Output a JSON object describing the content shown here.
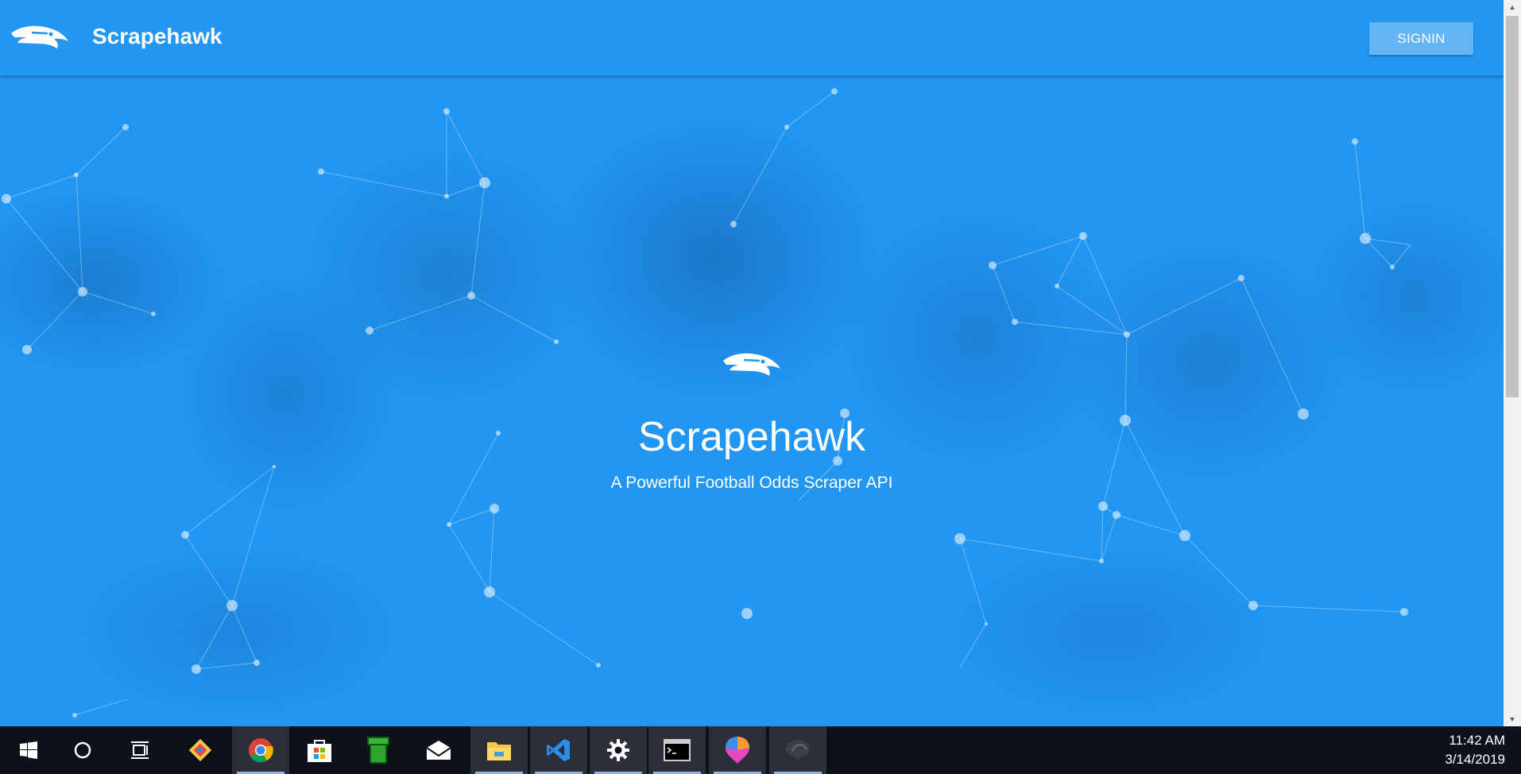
{
  "app": {
    "title": "Scrapehawk",
    "logo_icon": "seahawk-logo-icon",
    "signin_label": "SIGNIN",
    "colors": {
      "primary": "#2196F3",
      "button": "#64B5F6",
      "text": "#FFFFFF"
    }
  },
  "hero": {
    "title": "Scrapehawk",
    "subtitle": "A Powerful Football Odds Scraper API"
  },
  "taskbar": {
    "items": [
      {
        "name": "windows-start-icon",
        "active": false
      },
      {
        "name": "cortana-search-icon",
        "active": false
      },
      {
        "name": "task-view-icon",
        "active": false
      },
      {
        "name": "git-app-icon",
        "active": false
      },
      {
        "name": "chrome-icon",
        "active": true
      },
      {
        "name": "microsoft-store-icon",
        "active": false
      },
      {
        "name": "green-pipe-app-icon",
        "active": false
      },
      {
        "name": "mail-icon",
        "active": false
      },
      {
        "name": "file-explorer-icon",
        "active": true
      },
      {
        "name": "vscode-icon",
        "active": true
      },
      {
        "name": "settings-gear-icon",
        "active": true
      },
      {
        "name": "terminal-icon",
        "active": true
      },
      {
        "name": "paint-3d-icon",
        "active": true
      },
      {
        "name": "mongodb-compass-icon",
        "active": true
      }
    ],
    "time": "11:42 AM",
    "date": "3/14/2019"
  }
}
